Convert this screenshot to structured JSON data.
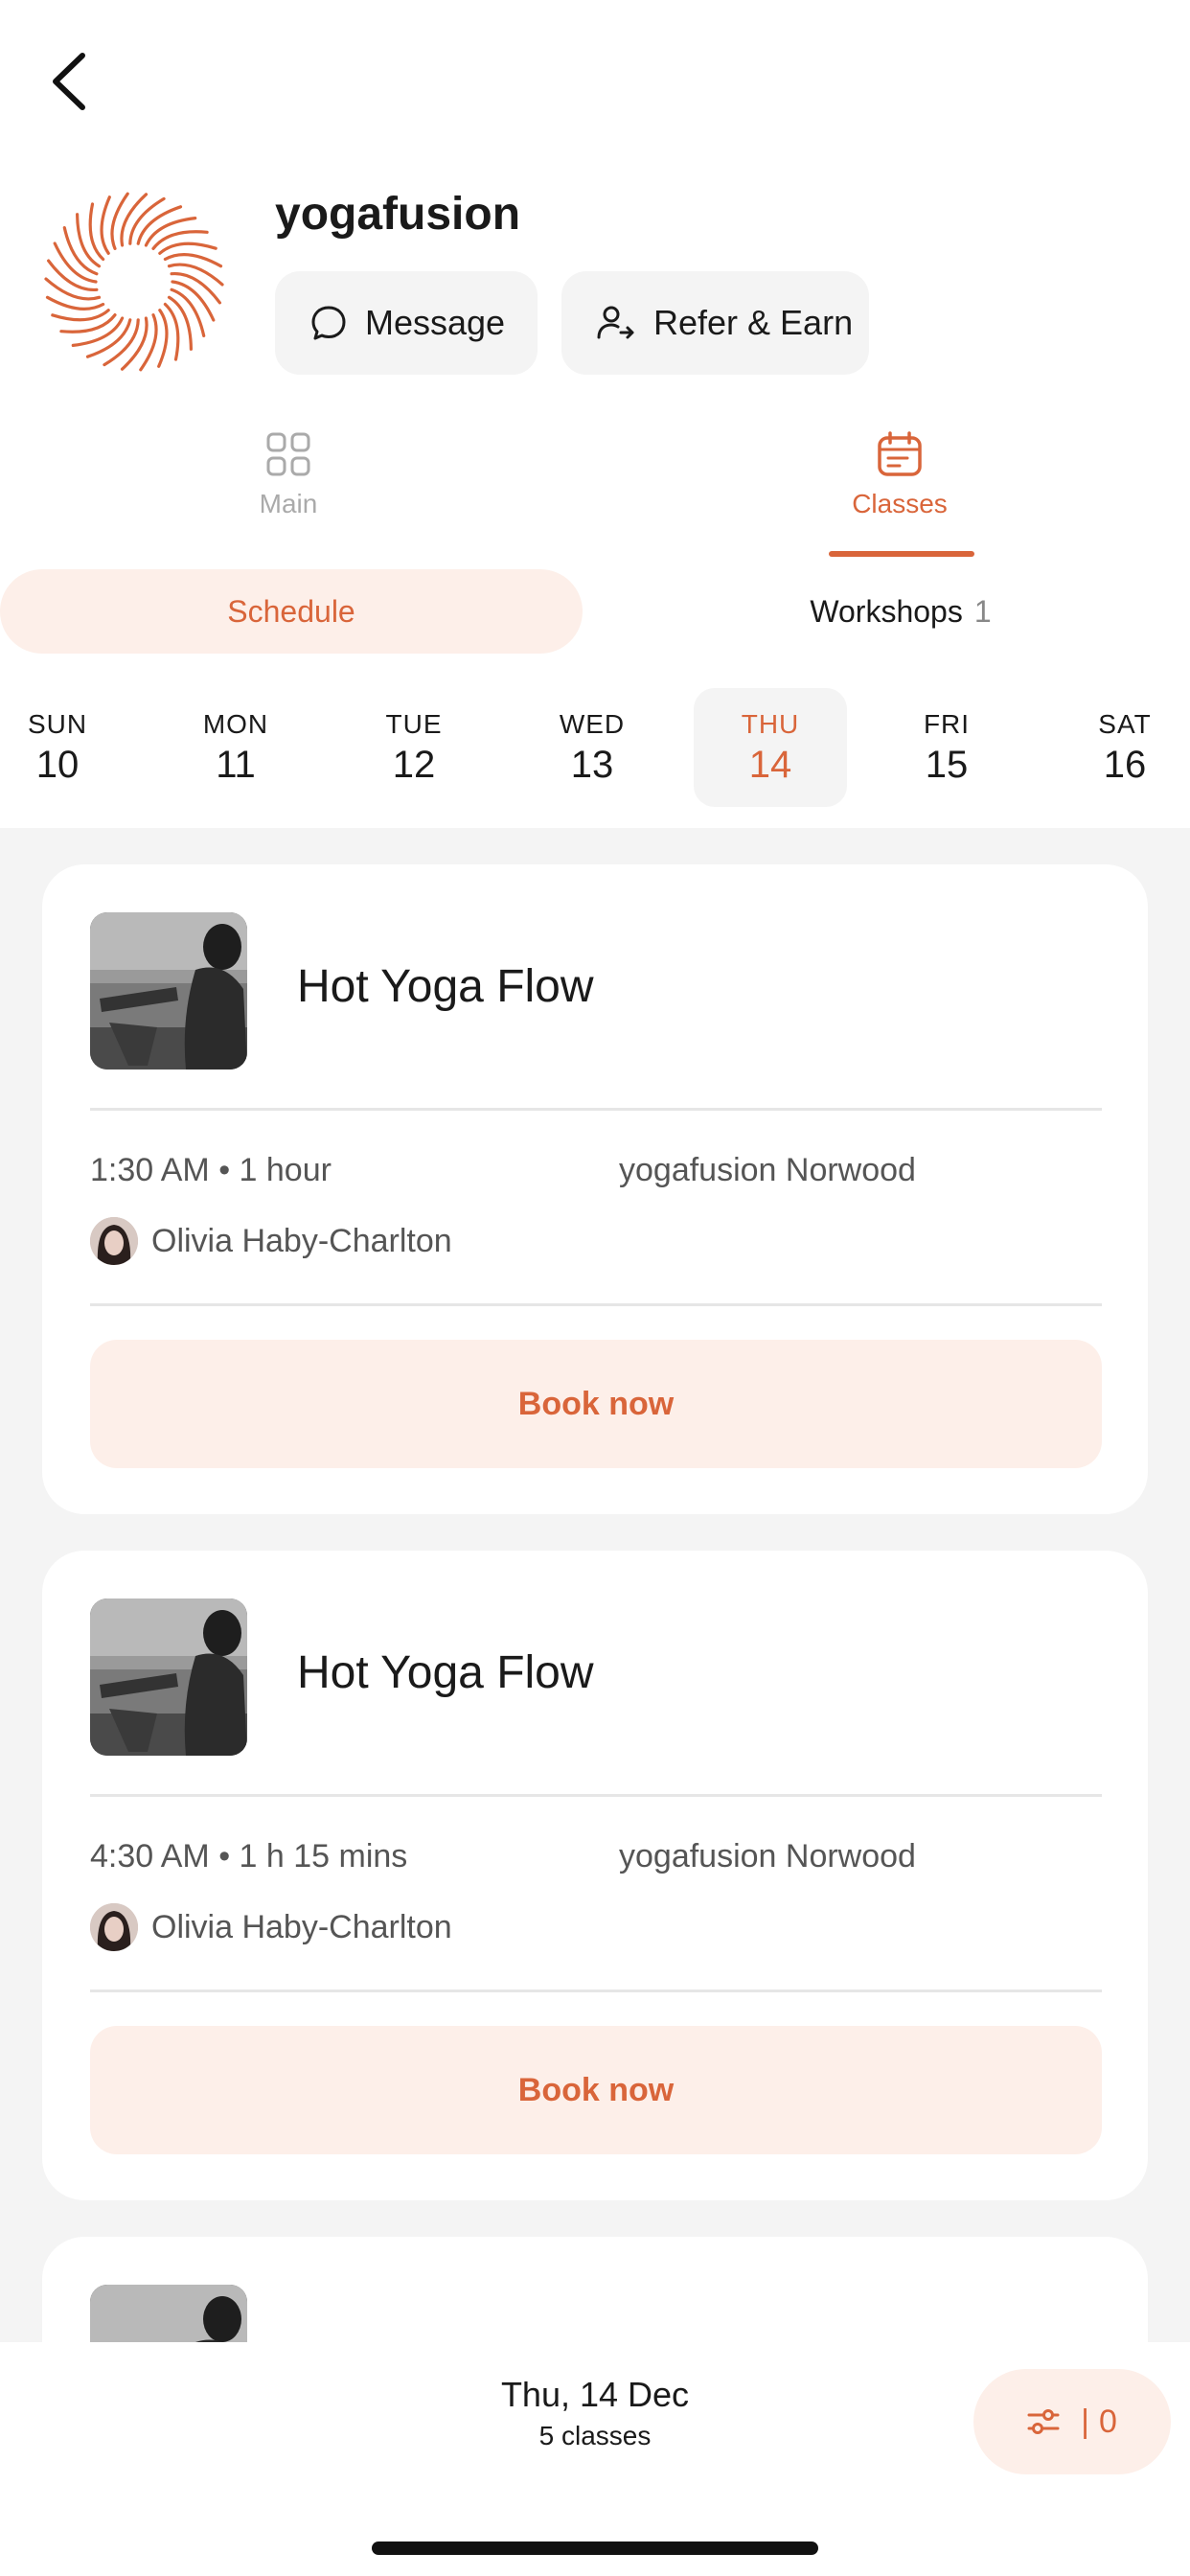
{
  "header": {
    "studio_name": "yogafusion"
  },
  "actions": {
    "message_label": "Message",
    "refer_label": "Refer & Earn"
  },
  "tabs": [
    {
      "label": "Main",
      "active": false
    },
    {
      "label": "Classes",
      "active": true
    }
  ],
  "segments": {
    "schedule_label": "Schedule",
    "workshops_label": "Workshops",
    "workshops_count": "1"
  },
  "days": [
    {
      "name": "SUN",
      "num": "10"
    },
    {
      "name": "MON",
      "num": "11"
    },
    {
      "name": "TUE",
      "num": "12"
    },
    {
      "name": "WED",
      "num": "13"
    },
    {
      "name": "THU",
      "num": "14",
      "selected": true
    },
    {
      "name": "FRI",
      "num": "15"
    },
    {
      "name": "SAT",
      "num": "16"
    }
  ],
  "classes": [
    {
      "title": "Hot Yoga Flow",
      "time": "1:30 AM • 1 hour",
      "location": "yogafusion Norwood",
      "instructor": "Olivia Haby-Charlton",
      "cta": "Book now"
    },
    {
      "title": "Hot Yoga Flow",
      "time": "4:30 AM • 1 h 15 mins",
      "location": "yogafusion Norwood",
      "instructor": "Olivia Haby-Charlton",
      "cta": "Book now"
    }
  ],
  "footer": {
    "date": "Thu, 14 Dec",
    "count": "5 classes",
    "filter_separator": "|",
    "filter_count": "0"
  },
  "colors": {
    "accent": "#d9653a",
    "accent_light": "#fdefe9",
    "surface": "#f4f4f4"
  },
  "icons": {
    "back": "chevron-left-icon",
    "message": "chat-bubble-icon",
    "refer": "user-share-icon",
    "main": "grid-icon",
    "classes": "calendar-icon",
    "filter": "sliders-icon"
  }
}
